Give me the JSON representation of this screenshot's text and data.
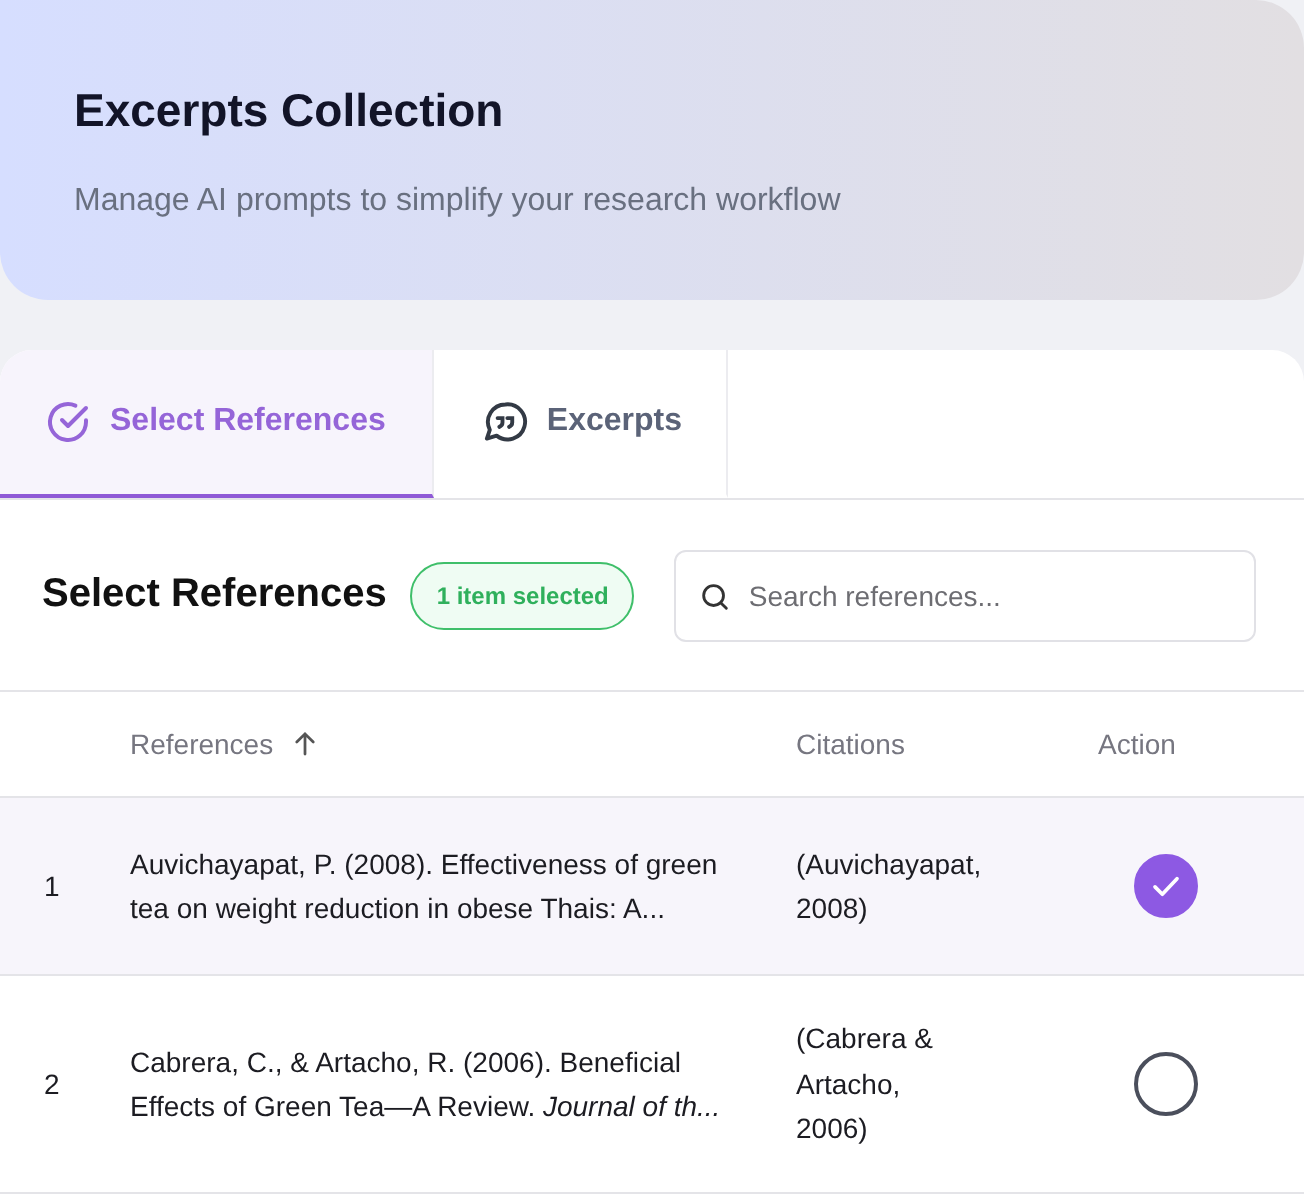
{
  "header": {
    "title": "Excerpts Collection",
    "subtitle": "Manage AI prompts to simplify your research workflow"
  },
  "tabs": [
    {
      "label": "Select References",
      "kind": "check",
      "selected": true
    },
    {
      "label": "Excerpts",
      "kind": "quote",
      "selected": false
    }
  ],
  "section": {
    "title": "Select References",
    "badge": "1 item selected",
    "search": {
      "placeholder": "Search references..."
    }
  },
  "table": {
    "columns": [
      {
        "label": "References",
        "sorted": true
      },
      {
        "label": "Citations",
        "sorted": false
      },
      {
        "label": "Action",
        "sorted": false
      }
    ],
    "rows": [
      {
        "index": "1",
        "reference": "Auvichayapat, P. (2008). Effectiveness of green tea on weight reduction in obese Thais: A...",
        "citation": "(Auvichayapat, 2008)",
        "selected": true
      },
      {
        "index": "2",
        "reference": "Cabrera, C., & Artacho, R. (2006). Beneficial Effects of Green Tea—A Review. *Journal of th...*",
        "citation": "(Cabrera & Artacho, 2006)",
        "selected": false
      }
    ]
  }
}
